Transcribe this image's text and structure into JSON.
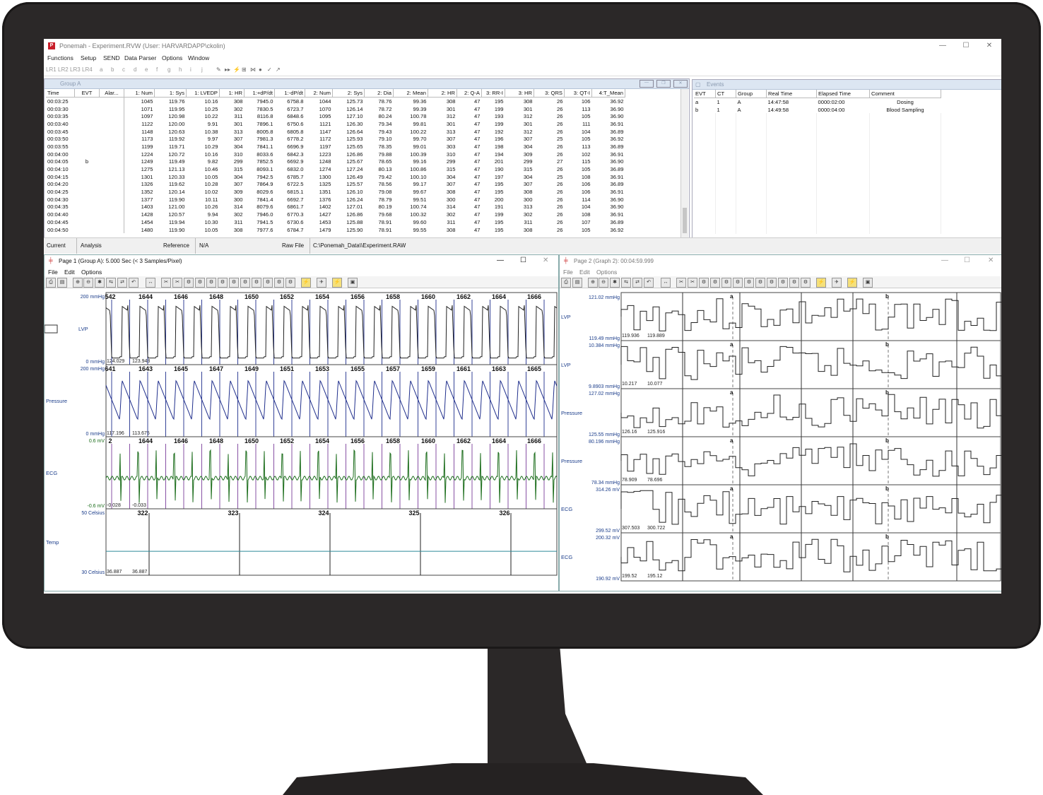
{
  "window": {
    "title": "Ponemah - Experiment.RVW (User: HARVARDAPP\\ckolin)",
    "icon_label": "P",
    "min": "—",
    "max": "☐",
    "close": "✕"
  },
  "menu": [
    "Functions",
    "Setup",
    "SEND",
    "Data Parser",
    "Options",
    "Window"
  ],
  "toolbar": [
    "LR1",
    "LR2",
    "LR3",
    "LR4",
    "a",
    "b",
    "c",
    "d",
    "e",
    "f",
    "g",
    "h",
    "i",
    "j"
  ],
  "groupA": {
    "title": "Group A",
    "left_headers": [
      "Time",
      "EVT",
      "Alar..."
    ],
    "headers": [
      "1:  Num",
      "1:  Sys",
      "1: LVEDP",
      "1:  HR",
      "1:+dP/dt",
      "1:-dP/dt",
      "2:  Num",
      "2:  Sys",
      "2:  Dia",
      "2:  Mean",
      "2:  HR",
      "2:  Q-A",
      "3:  RR-I",
      "3:  HR",
      "3:  QRS",
      "3:  QT-I",
      "4:T_Mean"
    ],
    "rows": [
      [
        "00:03:25",
        "",
        "",
        "1045",
        "119.76",
        "10.16",
        "308",
        "7945.0",
        "6758.8",
        "1044",
        "125.73",
        "78.76",
        "99.36",
        "308",
        "47",
        "195",
        "308",
        "26",
        "106",
        "36.92"
      ],
      [
        "00:03:30",
        "",
        "",
        "1071",
        "119.95",
        "10.25",
        "302",
        "7830.5",
        "6723.7",
        "1070",
        "126.14",
        "78.72",
        "99.39",
        "301",
        "47",
        "199",
        "301",
        "26",
        "113",
        "36.90"
      ],
      [
        "00:03:35",
        "",
        "",
        "1097",
        "120.98",
        "10.22",
        "311",
        "8116.8",
        "6848.6",
        "1095",
        "127.10",
        "80.24",
        "100.78",
        "312",
        "47",
        "193",
        "312",
        "26",
        "105",
        "36.90"
      ],
      [
        "00:03:40",
        "",
        "",
        "1122",
        "120.00",
        "9.91",
        "301",
        "7896.1",
        "6750.6",
        "1121",
        "126.30",
        "79.34",
        "99.81",
        "301",
        "47",
        "199",
        "301",
        "26",
        "111",
        "36.91"
      ],
      [
        "00:03:45",
        "",
        "",
        "1148",
        "120.63",
        "10.38",
        "313",
        "8005.8",
        "6805.8",
        "1147",
        "126.64",
        "79.43",
        "100.22",
        "313",
        "47",
        "192",
        "312",
        "26",
        "104",
        "36.89"
      ],
      [
        "00:03:50",
        "",
        "",
        "1173",
        "119.92",
        "9.97",
        "307",
        "7981.3",
        "6778.2",
        "1172",
        "125.93",
        "79.10",
        "99.70",
        "307",
        "47",
        "196",
        "307",
        "25",
        "105",
        "36.92"
      ],
      [
        "00:03:55",
        "",
        "",
        "1199",
        "119.71",
        "10.29",
        "304",
        "7841.1",
        "6696.9",
        "1197",
        "125.65",
        "78.35",
        "99.01",
        "303",
        "47",
        "198",
        "304",
        "26",
        "113",
        "36.89"
      ],
      [
        "00:04:00",
        "",
        "",
        "1224",
        "120.72",
        "10.16",
        "310",
        "8033.6",
        "6842.3",
        "1223",
        "126.86",
        "79.88",
        "100.39",
        "310",
        "47",
        "194",
        "309",
        "26",
        "102",
        "36.91"
      ],
      [
        "00:04:05",
        "b",
        "",
        "1249",
        "119.49",
        "9.82",
        "299",
        "7852.5",
        "6692.9",
        "1248",
        "125.67",
        "78.65",
        "99.16",
        "299",
        "47",
        "201",
        "299",
        "27",
        "115",
        "36.90"
      ],
      [
        "00:04:10",
        "",
        "",
        "1275",
        "121.13",
        "10.46",
        "315",
        "8093.1",
        "6832.0",
        "1274",
        "127.24",
        "80.13",
        "100.86",
        "315",
        "47",
        "190",
        "315",
        "26",
        "105",
        "36.89"
      ],
      [
        "00:04:15",
        "",
        "",
        "1301",
        "120.33",
        "10.05",
        "304",
        "7942.5",
        "6785.7",
        "1300",
        "126.49",
        "79.42",
        "100.10",
        "304",
        "47",
        "197",
        "304",
        "25",
        "108",
        "36.91"
      ],
      [
        "00:04:20",
        "",
        "",
        "1326",
        "119.62",
        "10.28",
        "307",
        "7864.9",
        "6722.5",
        "1325",
        "125.57",
        "78.56",
        "99.17",
        "307",
        "47",
        "195",
        "307",
        "26",
        "106",
        "36.89"
      ],
      [
        "00:04:25",
        "",
        "",
        "1352",
        "120.14",
        "10.02",
        "309",
        "8029.6",
        "6815.1",
        "1351",
        "126.10",
        "79.08",
        "99.67",
        "308",
        "47",
        "195",
        "308",
        "26",
        "106",
        "36.91"
      ],
      [
        "00:04:30",
        "",
        "",
        "1377",
        "119.90",
        "10.11",
        "300",
        "7841.4",
        "6692.7",
        "1376",
        "126.24",
        "78.79",
        "99.51",
        "300",
        "47",
        "200",
        "300",
        "26",
        "114",
        "36.90"
      ],
      [
        "00:04:35",
        "",
        "",
        "1403",
        "121.00",
        "10.26",
        "314",
        "8079.6",
        "6861.7",
        "1402",
        "127.01",
        "80.19",
        "100.74",
        "314",
        "47",
        "191",
        "313",
        "26",
        "104",
        "36.90"
      ],
      [
        "00:04:40",
        "",
        "",
        "1428",
        "120.57",
        "9.94",
        "302",
        "7946.0",
        "6770.3",
        "1427",
        "126.86",
        "79.68",
        "100.32",
        "302",
        "47",
        "199",
        "302",
        "26",
        "108",
        "36.91"
      ],
      [
        "00:04:45",
        "",
        "",
        "1454",
        "119.94",
        "10.30",
        "311",
        "7941.5",
        "6730.6",
        "1453",
        "125.88",
        "78.91",
        "99.60",
        "311",
        "47",
        "195",
        "311",
        "26",
        "107",
        "36.89"
      ],
      [
        "00:04:50",
        "",
        "",
        "1480",
        "119.90",
        "10.05",
        "308",
        "7977.6",
        "6784.7",
        "1479",
        "125.90",
        "78.91",
        "99.55",
        "308",
        "47",
        "195",
        "308",
        "26",
        "105",
        "36.92"
      ]
    ]
  },
  "events": {
    "title": "Events",
    "headers": [
      "EVT",
      "CT",
      "Group",
      "Real Time",
      "Elapsed Time",
      "Comment"
    ],
    "rows": [
      [
        "a",
        "1",
        "A",
        "14:47:58",
        "0000:02:00",
        "Dosing"
      ],
      [
        "b",
        "1",
        "A",
        "14:49:58",
        "0000:04:00",
        "Blood Sampling"
      ]
    ]
  },
  "status": {
    "current": "Current",
    "analysis": "Analysis",
    "reference": "Reference",
    "ref_value": "N/A",
    "rawfile": "Raw File",
    "path": "C:\\Ponemah_Data\\\\Experiment.RAW"
  },
  "page1": {
    "title": "Page 1 (Group A): 5.000 Sec   (< 3 Samples/Pixel)",
    "menu": [
      "File",
      "Edit",
      "Options"
    ],
    "channels": [
      {
        "label": "LVP",
        "top": "200 mmHg",
        "bottom": "0 mmHg",
        "v1": "124.029",
        "v2": "123.948",
        "beats": [
          "542",
          "1644",
          "1646",
          "1648",
          "1650",
          "1652",
          "1654",
          "1656",
          "1658",
          "1660",
          "1662",
          "1664",
          "1666"
        ],
        "color": "#222222"
      },
      {
        "label": "Pressure",
        "top": "200 mmHg",
        "bottom": "0 mmHg",
        "v1": "117.196",
        "v2": "113.675",
        "beats": [
          "641",
          "1643",
          "1645",
          "1647",
          "1649",
          "1651",
          "1653",
          "1655",
          "1657",
          "1659",
          "1661",
          "1663",
          "1665"
        ],
        "color": "#1f2e8c"
      },
      {
        "label": "ECG",
        "top": "0.6 mV",
        "bottom": "-0.6 mV",
        "v1": "-0.028",
        "v2": "-0.033",
        "beats": [
          "2",
          "1644",
          "1646",
          "1648",
          "1650",
          "1652",
          "1654",
          "1656",
          "1658",
          "1660",
          "1662",
          "1664",
          "1666"
        ],
        "color": "#1d6e1d"
      },
      {
        "label": "Temp",
        "top": "50 Celsius",
        "bottom": "30 Celsius",
        "v1": "36.887",
        "v2": "36.887",
        "beats": [
          "322",
          "323",
          "324",
          "325",
          "326"
        ],
        "color": "#2e8b9a"
      }
    ]
  },
  "page2": {
    "title": "Page 2 (Graph 2): 00:04:59.999",
    "menu": [
      "File",
      "Edit",
      "Options"
    ],
    "markers": [
      "a",
      "b"
    ],
    "rows": [
      {
        "label": "LVP",
        "top": "121.02 mmHg",
        "bottom": "119.49 mmHg",
        "v1": "119.936",
        "v2": "119.889"
      },
      {
        "label": "LVP",
        "top": "10.384 mmHg",
        "bottom": "9.8903 mmHg",
        "v1": "10.217",
        "v2": "10.077"
      },
      {
        "label": "Pressure",
        "top": "127.02 mmHg",
        "bottom": "125.55 mmHg",
        "v1": "126.16",
        "v2": "125.916"
      },
      {
        "label": "Pressure",
        "top": "80.196 mmHg",
        "bottom": "78.34 mmHg",
        "v1": "78.909",
        "v2": "78.696"
      },
      {
        "label": "ECG",
        "top": "314.26 mV",
        "bottom": "299.52 mV",
        "v1": "307.503",
        "v2": "300.722"
      },
      {
        "label": "ECG",
        "top": "200.32 mV",
        "bottom": "190.92 mV",
        "v1": "199.52",
        "v2": "195.12"
      }
    ]
  }
}
